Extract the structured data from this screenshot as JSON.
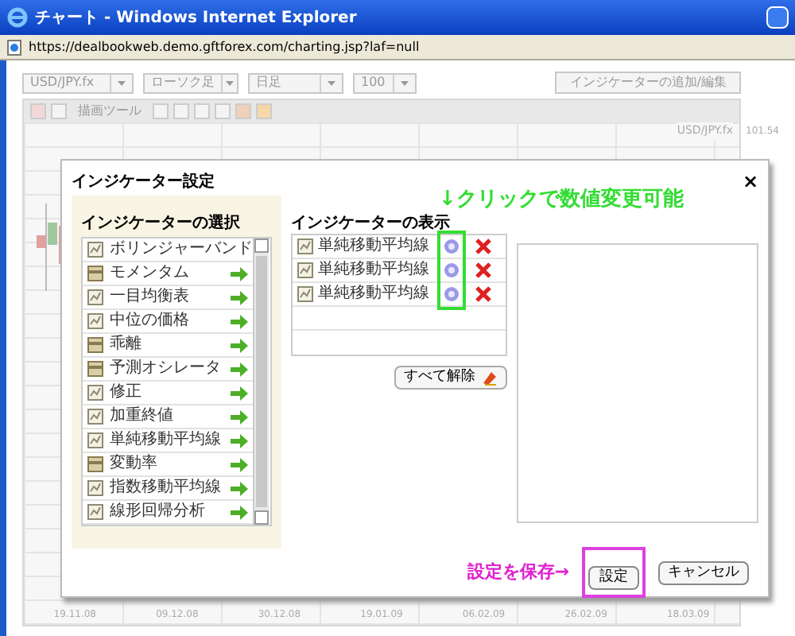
{
  "window": {
    "title": "チャート - Windows Internet Explorer"
  },
  "address_bar": {
    "url": "https://dealbookweb.demo.gftforex.com/charting.jsp?laf=null"
  },
  "toolbar": {
    "dropdowns": [
      {
        "value": "USD/JPY.fx"
      },
      {
        "value": "ローソク足"
      },
      {
        "value": "日足"
      },
      {
        "value": "100"
      }
    ],
    "indicator_button": "インジケーターの追加/編集",
    "drawing_tools_label": "描画ツール"
  },
  "chart": {
    "symbol": "USD/JPY.fx",
    "y_labels": [
      "101.54"
    ],
    "x_labels": [
      "19.11.08",
      "09.12.08",
      "30.12.08",
      "19.01.09",
      "06.02.09",
      "26.02.09",
      "18.03.09"
    ]
  },
  "dialog": {
    "title": "インジケーター設定",
    "close": "×",
    "select_heading": "インジケーターの選択",
    "indicators": [
      {
        "label": "ボリンジャーバンド",
        "kind": "line"
      },
      {
        "label": "モメンタム",
        "kind": "panel"
      },
      {
        "label": "一目均衡表",
        "kind": "line"
      },
      {
        "label": "中位の価格",
        "kind": "line"
      },
      {
        "label": "乖離",
        "kind": "panel"
      },
      {
        "label": "予測オシレータ",
        "kind": "panel"
      },
      {
        "label": "修正",
        "kind": "line"
      },
      {
        "label": "加重終値",
        "kind": "line"
      },
      {
        "label": "単純移動平均線",
        "kind": "line"
      },
      {
        "label": "変動率",
        "kind": "panel"
      },
      {
        "label": "指数移動平均線",
        "kind": "line"
      },
      {
        "label": "線形回帰分析",
        "kind": "line"
      }
    ],
    "display_heading": "インジケーターの表示",
    "active": [
      {
        "label": "単純移動平均線"
      },
      {
        "label": "単純移動平均線"
      },
      {
        "label": "単純移動平均線"
      }
    ],
    "clear_all_button": "すべて解除",
    "save_button": "設定",
    "cancel_button": "キャンセル"
  },
  "annotations": {
    "click_hint": "↓クリックで数値変更可能",
    "save_hint": "設定を保存→"
  }
}
